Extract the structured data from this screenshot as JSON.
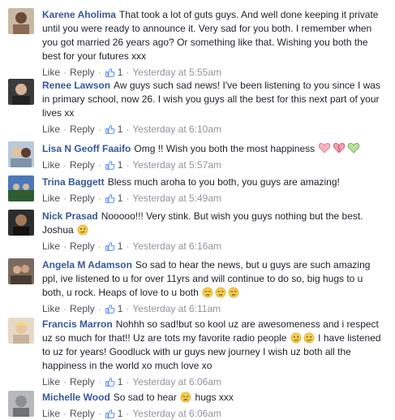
{
  "comments": [
    {
      "author": "Karene Aholima",
      "text": "That took a lot of guts guys. And well done keeping it private until you were ready to announce it. Very sad for you both. I remember when you got married 26 years ago? Or something like that. Wishing you both the best for your futures xxx",
      "like": "Like",
      "reply": "Reply",
      "likes": "1",
      "time": "Yesterday at 5:55am"
    },
    {
      "author": "Renee Lawson",
      "text": "Aw guys such sad news! I've been listening to you since I was in primary school, now 26. I wish you guys all the best for this next part of your lives xx",
      "like": "Like",
      "reply": "Reply",
      "likes": "1",
      "time": "Yesterday at 6:10am"
    },
    {
      "author": "Lisa N Geoff Faaifo",
      "text": "Omg !! Wish you both the most happiness",
      "emojis": [
        "pink-heart-icon",
        "broken-heart-icon",
        "green-heart-icon"
      ],
      "like": "Like",
      "reply": "Reply",
      "likes": "1",
      "time": "Yesterday at 5:57am"
    },
    {
      "author": "Trina Baggett",
      "text": "Bless much aroha to you both, you guys are amazing!",
      "like": "Like",
      "reply": "Reply",
      "likes": "1",
      "time": "Yesterday at 5:49am"
    },
    {
      "author": "Nick Prasad",
      "text": "Nooooo!!! Very stink. But wish you guys nothing but the best.",
      "mention": "Joshua",
      "emojis": [
        "confused-face-icon"
      ],
      "like": "Like",
      "reply": "Reply",
      "likes": "1",
      "time": "Yesterday at 6:16am"
    },
    {
      "author": "Angela M Adamson",
      "text": "So sad to hear the news, but u guys are such amazing ppl, ive listened to u for over 11yrs and will continue to do so, big hugs to u both, u rock. Heaps of love to u both",
      "emojis": [
        "crying-face-icon",
        "crying-face-icon",
        "crying-face-icon"
      ],
      "like": "Like",
      "reply": "Reply",
      "likes": "1",
      "time": "Yesterday at 6:11am"
    },
    {
      "author": "Francis Marron",
      "text_a": "Nohhh so sad!but so kool uz are awesomeness and i respect uz so much for that!! Uz are tots my favorite radio people",
      "emojis": [
        "smirk-face-icon",
        "smirk-face-icon"
      ],
      "text_b": "I have listened to uz for years! Goodluck with ur guys new journey I wish uz both all the happiness in the world xo much love xo",
      "like": "Like",
      "reply": "Reply",
      "likes": "1",
      "time": "Yesterday at 6:06am"
    },
    {
      "author": "Michelle Wood",
      "text_a": "So sad to hear",
      "emojis": [
        "disappointed-face-icon"
      ],
      "text_b": "hugs xxx",
      "like": "Like",
      "reply": "Reply",
      "likes": "1",
      "time": "Yesterday at 6:06am"
    }
  ],
  "colors": {
    "author": "#365899",
    "text": "#1d2129",
    "meta": "#90949c",
    "like_blue": "#5890ff"
  }
}
